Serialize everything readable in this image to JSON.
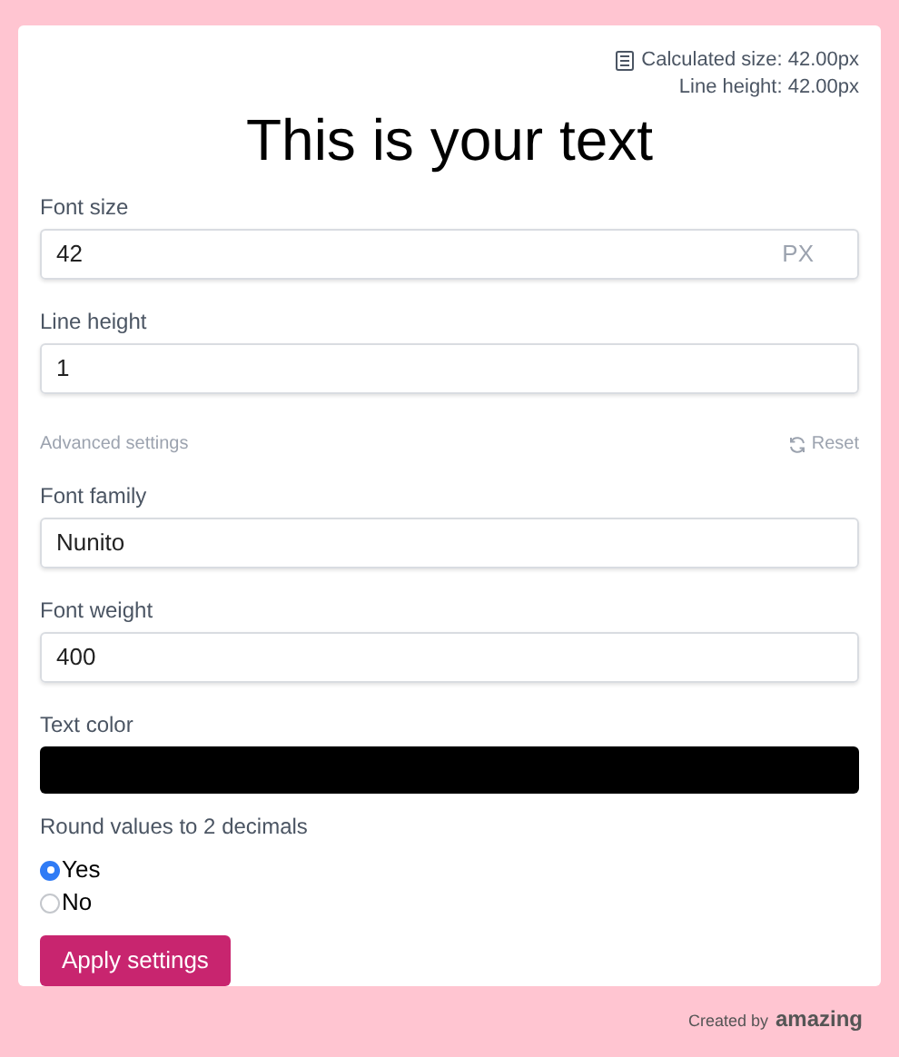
{
  "info": {
    "calculated_size": "Calculated size: 42.00px",
    "line_height": "Line height: 42.00px"
  },
  "preview": {
    "text": "This is your text"
  },
  "basic_fields": [
    {
      "label": "Font size",
      "value": "42",
      "unit": "PX"
    },
    {
      "label": "Line height",
      "value": "1"
    }
  ],
  "advanced": {
    "title": "Advanced settings",
    "reset": "Reset"
  },
  "advanced_fields": [
    {
      "kind": "text",
      "label": "Font family",
      "value": "Nunito"
    },
    {
      "kind": "text",
      "label": "Font weight",
      "value": "400"
    },
    {
      "kind": "color",
      "label": "Text color",
      "color": "#000000"
    }
  ],
  "rounding": {
    "label": "Round values to 2 decimals",
    "options": [
      {
        "label": "Yes",
        "selected": true
      },
      {
        "label": "No",
        "selected": false
      }
    ]
  },
  "apply_button": "Apply settings",
  "footer": {
    "prefix": "Created by",
    "brand": "amazing"
  }
}
